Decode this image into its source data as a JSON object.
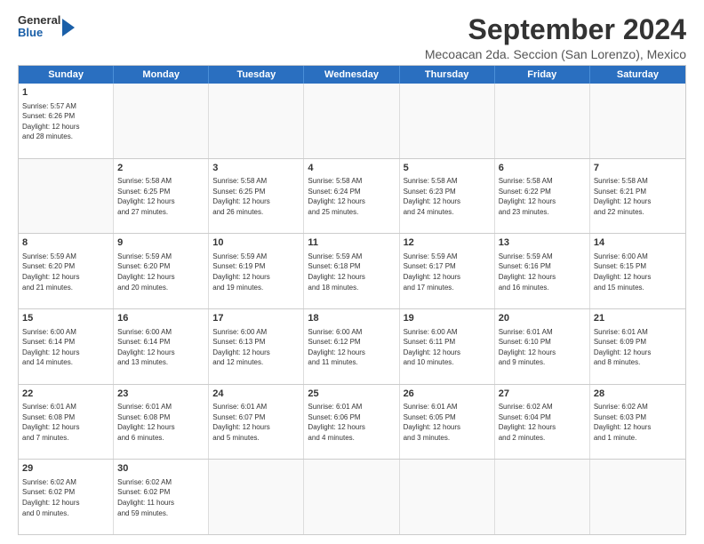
{
  "header": {
    "logo": {
      "line1": "General",
      "line2": "Blue"
    },
    "title": "September 2024",
    "subtitle": "Mecoacan 2da. Seccion (San Lorenzo), Mexico"
  },
  "calendar": {
    "days_of_week": [
      "Sunday",
      "Monday",
      "Tuesday",
      "Wednesday",
      "Thursday",
      "Friday",
      "Saturday"
    ],
    "rows": [
      [
        {
          "day": "",
          "info": ""
        },
        {
          "day": "2",
          "info": "Sunrise: 5:58 AM\nSunset: 6:25 PM\nDaylight: 12 hours\nand 27 minutes."
        },
        {
          "day": "3",
          "info": "Sunrise: 5:58 AM\nSunset: 6:25 PM\nDaylight: 12 hours\nand 26 minutes."
        },
        {
          "day": "4",
          "info": "Sunrise: 5:58 AM\nSunset: 6:24 PM\nDaylight: 12 hours\nand 25 minutes."
        },
        {
          "day": "5",
          "info": "Sunrise: 5:58 AM\nSunset: 6:23 PM\nDaylight: 12 hours\nand 24 minutes."
        },
        {
          "day": "6",
          "info": "Sunrise: 5:58 AM\nSunset: 6:22 PM\nDaylight: 12 hours\nand 23 minutes."
        },
        {
          "day": "7",
          "info": "Sunrise: 5:58 AM\nSunset: 6:21 PM\nDaylight: 12 hours\nand 22 minutes."
        }
      ],
      [
        {
          "day": "8",
          "info": "Sunrise: 5:59 AM\nSunset: 6:20 PM\nDaylight: 12 hours\nand 21 minutes."
        },
        {
          "day": "9",
          "info": "Sunrise: 5:59 AM\nSunset: 6:20 PM\nDaylight: 12 hours\nand 20 minutes."
        },
        {
          "day": "10",
          "info": "Sunrise: 5:59 AM\nSunset: 6:19 PM\nDaylight: 12 hours\nand 19 minutes."
        },
        {
          "day": "11",
          "info": "Sunrise: 5:59 AM\nSunset: 6:18 PM\nDaylight: 12 hours\nand 18 minutes."
        },
        {
          "day": "12",
          "info": "Sunrise: 5:59 AM\nSunset: 6:17 PM\nDaylight: 12 hours\nand 17 minutes."
        },
        {
          "day": "13",
          "info": "Sunrise: 5:59 AM\nSunset: 6:16 PM\nDaylight: 12 hours\nand 16 minutes."
        },
        {
          "day": "14",
          "info": "Sunrise: 6:00 AM\nSunset: 6:15 PM\nDaylight: 12 hours\nand 15 minutes."
        }
      ],
      [
        {
          "day": "15",
          "info": "Sunrise: 6:00 AM\nSunset: 6:14 PM\nDaylight: 12 hours\nand 14 minutes."
        },
        {
          "day": "16",
          "info": "Sunrise: 6:00 AM\nSunset: 6:14 PM\nDaylight: 12 hours\nand 13 minutes."
        },
        {
          "day": "17",
          "info": "Sunrise: 6:00 AM\nSunset: 6:13 PM\nDaylight: 12 hours\nand 12 minutes."
        },
        {
          "day": "18",
          "info": "Sunrise: 6:00 AM\nSunset: 6:12 PM\nDaylight: 12 hours\nand 11 minutes."
        },
        {
          "day": "19",
          "info": "Sunrise: 6:00 AM\nSunset: 6:11 PM\nDaylight: 12 hours\nand 10 minutes."
        },
        {
          "day": "20",
          "info": "Sunrise: 6:01 AM\nSunset: 6:10 PM\nDaylight: 12 hours\nand 9 minutes."
        },
        {
          "day": "21",
          "info": "Sunrise: 6:01 AM\nSunset: 6:09 PM\nDaylight: 12 hours\nand 8 minutes."
        }
      ],
      [
        {
          "day": "22",
          "info": "Sunrise: 6:01 AM\nSunset: 6:08 PM\nDaylight: 12 hours\nand 7 minutes."
        },
        {
          "day": "23",
          "info": "Sunrise: 6:01 AM\nSunset: 6:08 PM\nDaylight: 12 hours\nand 6 minutes."
        },
        {
          "day": "24",
          "info": "Sunrise: 6:01 AM\nSunset: 6:07 PM\nDaylight: 12 hours\nand 5 minutes."
        },
        {
          "day": "25",
          "info": "Sunrise: 6:01 AM\nSunset: 6:06 PM\nDaylight: 12 hours\nand 4 minutes."
        },
        {
          "day": "26",
          "info": "Sunrise: 6:01 AM\nSunset: 6:05 PM\nDaylight: 12 hours\nand 3 minutes."
        },
        {
          "day": "27",
          "info": "Sunrise: 6:02 AM\nSunset: 6:04 PM\nDaylight: 12 hours\nand 2 minutes."
        },
        {
          "day": "28",
          "info": "Sunrise: 6:02 AM\nSunset: 6:03 PM\nDaylight: 12 hours\nand 1 minute."
        }
      ],
      [
        {
          "day": "29",
          "info": "Sunrise: 6:02 AM\nSunset: 6:02 PM\nDaylight: 12 hours\nand 0 minutes."
        },
        {
          "day": "30",
          "info": "Sunrise: 6:02 AM\nSunset: 6:02 PM\nDaylight: 11 hours\nand 59 minutes."
        },
        {
          "day": "",
          "info": ""
        },
        {
          "day": "",
          "info": ""
        },
        {
          "day": "",
          "info": ""
        },
        {
          "day": "",
          "info": ""
        },
        {
          "day": "",
          "info": ""
        }
      ]
    ],
    "first_row": [
      {
        "day": "1",
        "info": "Sunrise: 5:57 AM\nSunset: 6:26 PM\nDaylight: 12 hours\nand 28 minutes."
      },
      {
        "day": "",
        "info": ""
      },
      {
        "day": "",
        "info": ""
      },
      {
        "day": "",
        "info": ""
      },
      {
        "day": "",
        "info": ""
      },
      {
        "day": "",
        "info": ""
      },
      {
        "day": "",
        "info": ""
      }
    ]
  }
}
